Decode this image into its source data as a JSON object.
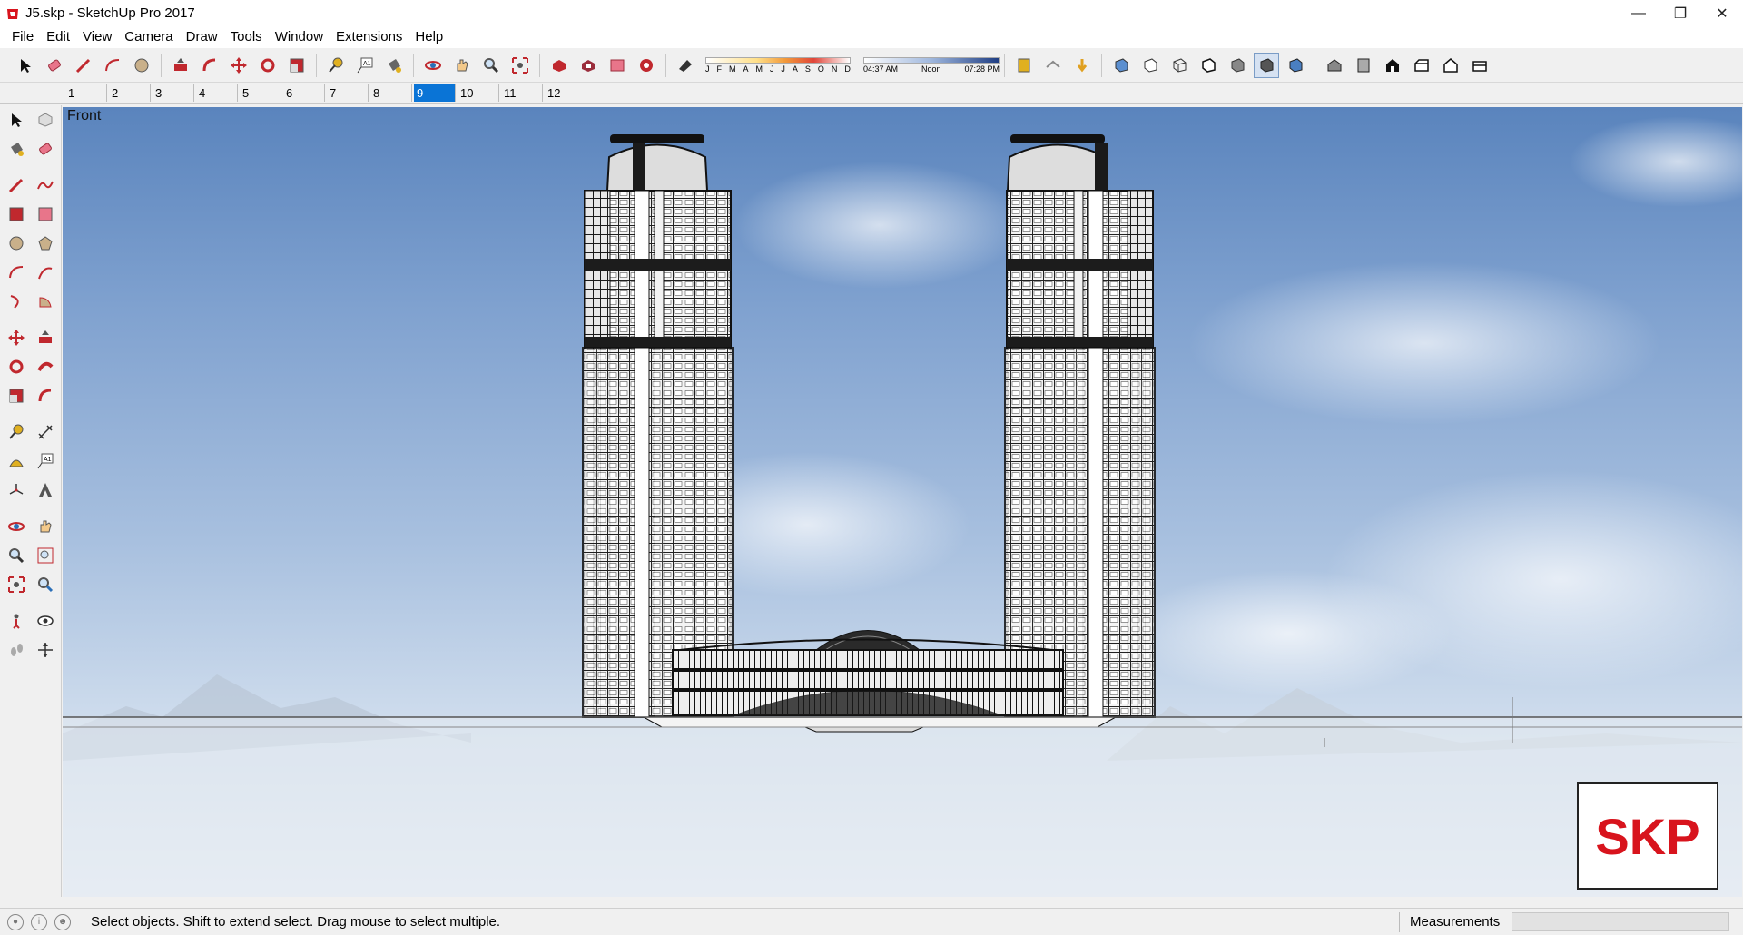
{
  "window": {
    "title": "J5.skp - SketchUp Pro 2017",
    "minimize_icon": "minimize-icon",
    "maximize_icon": "restore-icon",
    "close_icon": "close-icon"
  },
  "menu": [
    "File",
    "Edit",
    "View",
    "Camera",
    "Draw",
    "Tools",
    "Window",
    "Extensions",
    "Help"
  ],
  "shadows": {
    "months": [
      "J",
      "F",
      "M",
      "A",
      "M",
      "J",
      "J",
      "A",
      "S",
      "O",
      "N",
      "D"
    ],
    "time_start": "04:37 AM",
    "time_mid": "Noon",
    "time_end": "07:28 PM"
  },
  "scene_tabs": [
    "1",
    "2",
    "3",
    "4",
    "5",
    "6",
    "7",
    "8",
    "9",
    "10",
    "11",
    "12"
  ],
  "active_scene": "9",
  "viewport": {
    "label": "Front",
    "watermark": "SKP"
  },
  "status": {
    "text": "Select objects. Shift to extend select. Drag mouse to select multiple.",
    "measurements_label": "Measurements",
    "measurements_value": ""
  },
  "colors": {
    "accent": "#0a74d6",
    "tool_red": "#c0282e",
    "brand_red": "#d8141d"
  }
}
